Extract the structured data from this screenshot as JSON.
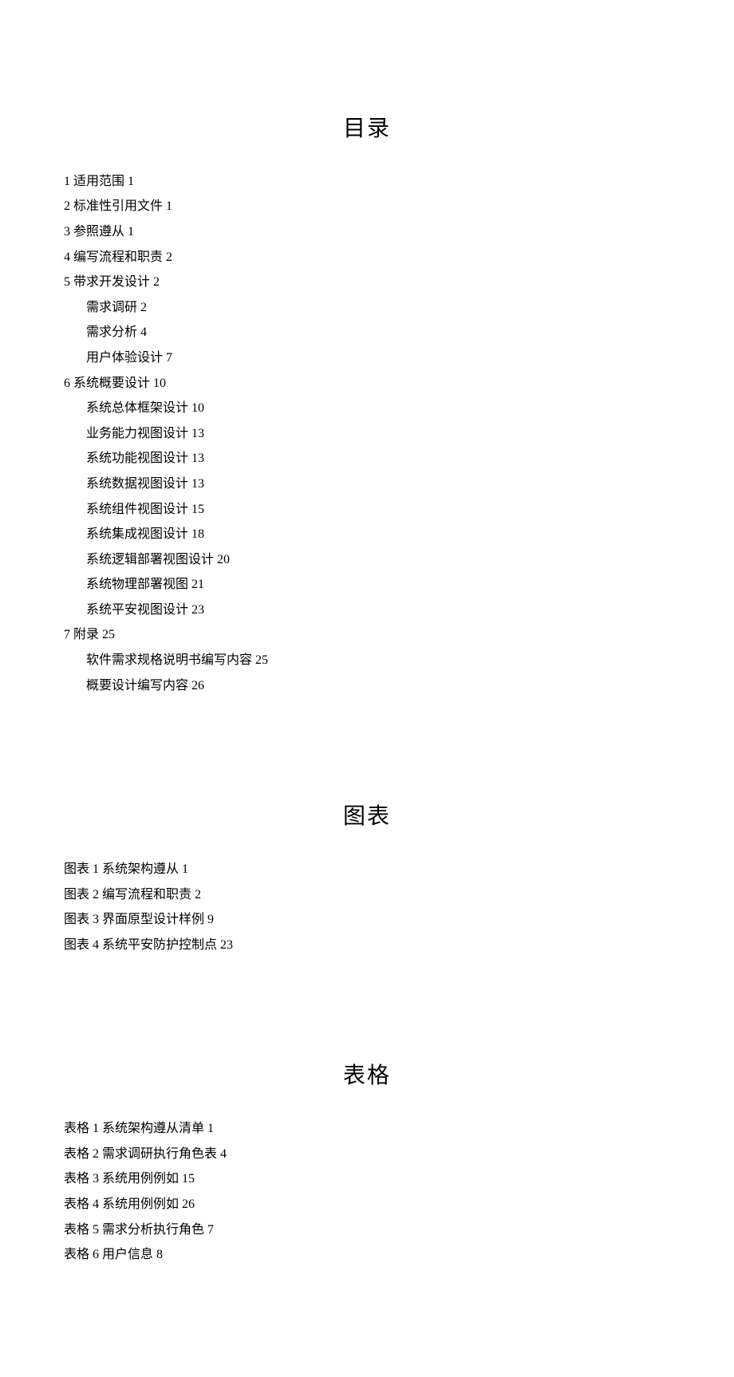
{
  "headings": {
    "toc": "目录",
    "figures": "图表",
    "tables": "表格"
  },
  "toc": [
    {
      "level": 1,
      "label": "1 适用范围 1"
    },
    {
      "level": 1,
      "label": "2 标准性引用文件 1"
    },
    {
      "level": 1,
      "label": "3 参照遵从 1"
    },
    {
      "level": 1,
      "label": "4 编写流程和职责 2"
    },
    {
      "level": 1,
      "label": "5 带求开发设计 2"
    },
    {
      "level": 2,
      "label": "需求调研 2"
    },
    {
      "level": 2,
      "label": "需求分析 4"
    },
    {
      "level": 2,
      "label": "用户体验设计 7"
    },
    {
      "level": 1,
      "label": "6 系统概要设计 10"
    },
    {
      "level": 2,
      "label": "系统总体框架设计 10"
    },
    {
      "level": 2,
      "label": "业务能力视图设计 13"
    },
    {
      "level": 2,
      "label": "系统功能视图设计 13"
    },
    {
      "level": 2,
      "label": "系统数据视图设计 13"
    },
    {
      "level": 2,
      "label": "系统组件视图设计 15"
    },
    {
      "level": 2,
      "label": "系统集成视图设计 18"
    },
    {
      "level": 2,
      "label": "系统逻辑部署视图设计 20"
    },
    {
      "level": 2,
      "label": "系统物理部署视图 21"
    },
    {
      "level": 2,
      "label": "系统平安视图设计 23"
    },
    {
      "level": 1,
      "label": "7 附录 25"
    },
    {
      "level": 2,
      "label": "软件需求规格说明书编写内容 25"
    },
    {
      "level": 2,
      "label": "概要设计编写内容 26"
    }
  ],
  "figures": [
    {
      "label": "图表 1 系统架构遵从 1"
    },
    {
      "label": "图表 2 编写流程和职责 2"
    },
    {
      "label": "图表 3 界面原型设计样例 9"
    },
    {
      "label": "图表 4 系统平安防护控制点 23"
    }
  ],
  "tables": [
    {
      "label": "表格 1 系统架构遵从清单 1"
    },
    {
      "label": "表格 2 需求调研执行角色表 4"
    },
    {
      "label": "表格 3 系统用例例如 15"
    },
    {
      "label": "表格 4 系统用例例如 26"
    },
    {
      "label": "表格 5 需求分析执行角色 7"
    },
    {
      "label": "表格 6 用户信息 8"
    }
  ]
}
